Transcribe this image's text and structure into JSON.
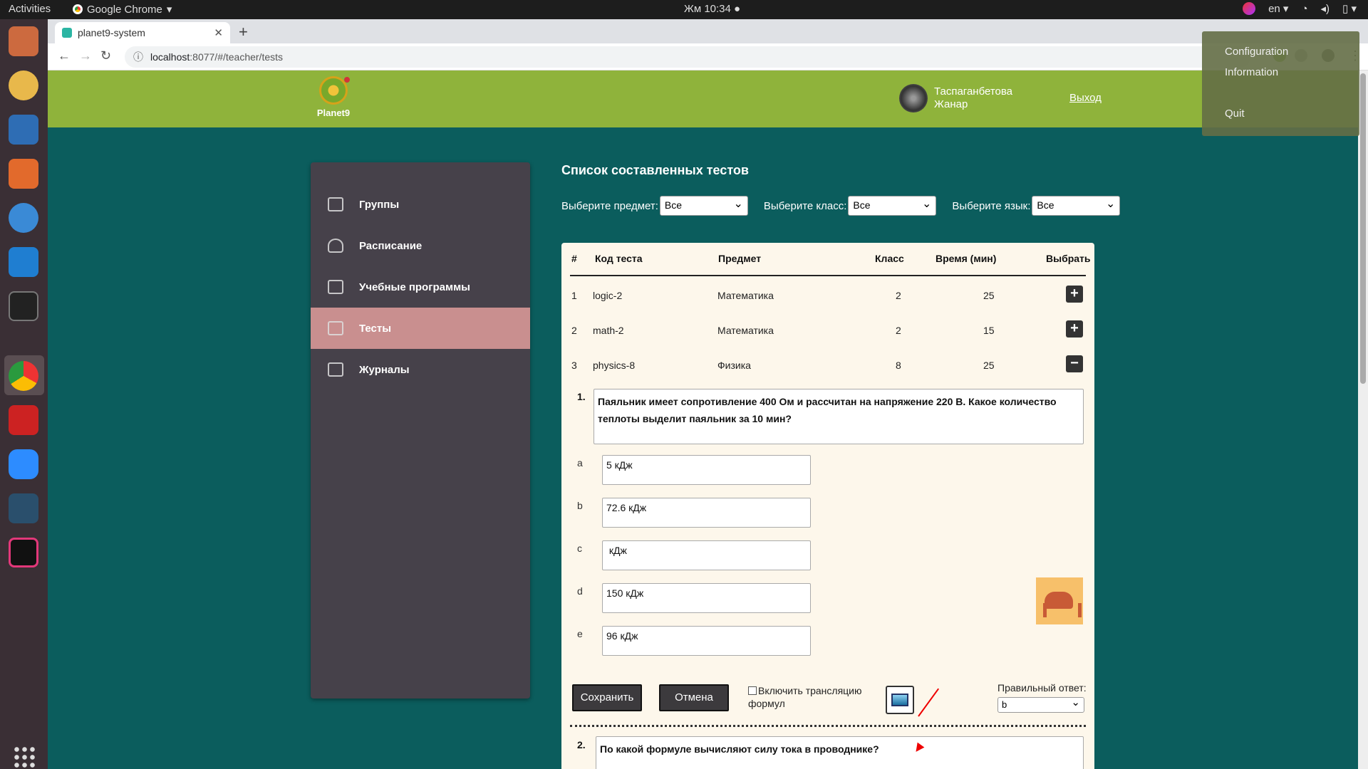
{
  "system": {
    "activities": "Activities",
    "app_name": "Google Chrome",
    "clock": "Жм 10:34",
    "lang": "en"
  },
  "browser": {
    "tab_title": "planet9-system",
    "url_host": "localhost",
    "url_rest": ":8077/#/teacher/tests"
  },
  "popup_menu": {
    "items": [
      "Configuration",
      "Information",
      "Quit"
    ]
  },
  "header": {
    "logo_text": "Planet9",
    "user_name_line1": "Таспаганбетова",
    "user_name_line2": "Жанар",
    "logout": "Выход"
  },
  "sidebar": {
    "items": [
      {
        "label": "Группы",
        "icon": "groups-icon"
      },
      {
        "label": "Расписание",
        "icon": "bell-icon"
      },
      {
        "label": "Учебные программы",
        "icon": "newspaper-icon"
      },
      {
        "label": "Тесты",
        "icon": "checklist-icon"
      },
      {
        "label": "Журналы",
        "icon": "journal-icon"
      }
    ],
    "active_index": 3
  },
  "main": {
    "title": "Список составленных тестов",
    "filter_subject_label": "Выберите предмет:",
    "filter_subject_value": "Все",
    "filter_class_label": "Выберите класс:",
    "filter_class_value": "Все",
    "filter_lang_label": "Выберите язык:",
    "filter_lang_value": "Все"
  },
  "table": {
    "headers": [
      "#",
      "Код теста",
      "Предмет",
      "Класс",
      "Время (мин)",
      "Выбрать"
    ],
    "rows": [
      {
        "n": "1",
        "code": "logic-2",
        "subject": "Математика",
        "class": "2",
        "time": "25",
        "action": "+"
      },
      {
        "n": "2",
        "code": "math-2",
        "subject": "Математика",
        "class": "2",
        "time": "15",
        "action": "+"
      },
      {
        "n": "3",
        "code": "physics-8",
        "subject": "Физика",
        "class": "8",
        "time": "25",
        "action": "−"
      }
    ]
  },
  "editor": {
    "q1_num": "1.",
    "q1_text": "Паяльник имеет сопротивление 400 Ом и рассчитан на напряжение 220 В. Какое количество теплоты выделит паяльник за 10 мин?",
    "options": [
      {
        "label": "a",
        "value": "5 кДж"
      },
      {
        "label": "b",
        "value": "72.6 кДж"
      },
      {
        "label": "c",
        "value": " кДж"
      },
      {
        "label": "d",
        "value": "150 кДж"
      },
      {
        "label": "e",
        "value": "96 кДж"
      }
    ],
    "save": "Сохранить",
    "cancel": "Отмена",
    "formula_line1": "Включить трансляцию",
    "formula_line2": "формул",
    "correct_label": "Правильный ответ:",
    "correct_value": "b",
    "q2_num": "2.",
    "q2_text": "По какой формуле вычисляют силу тока в проводнике?"
  }
}
